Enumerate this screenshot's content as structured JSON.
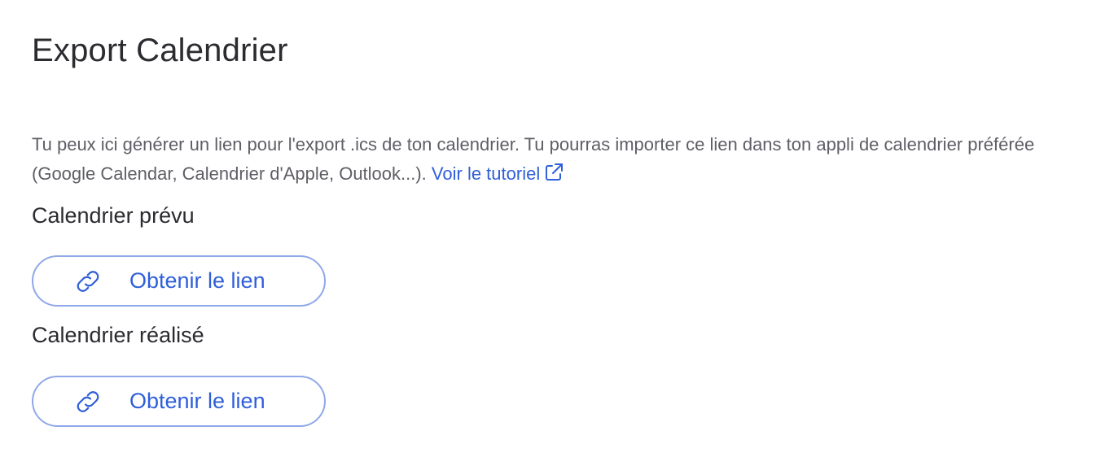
{
  "page": {
    "title": "Export Calendrier"
  },
  "description": {
    "text": "Tu peux ici générer un lien pour l'export .ics de ton calendrier. Tu pourras importer ce lien dans ton appli de calendrier préférée (Google Calendar, Calendrier d'Apple, Outlook...). ",
    "tutorial_link": "Voir le tutoriel",
    "tutorial_icon": "external-link-icon"
  },
  "sections": [
    {
      "heading": "Calendrier prévu",
      "button_label": "Obtenir le lien",
      "button_icon": "link-icon"
    },
    {
      "heading": "Calendrier réalisé",
      "button_label": "Obtenir le lien",
      "button_icon": "link-icon"
    }
  ],
  "colors": {
    "accent": "#2f5fd9",
    "button_border": "#8fa8e8",
    "heading_text": "#2b2b30",
    "body_text": "#5e5e66"
  }
}
